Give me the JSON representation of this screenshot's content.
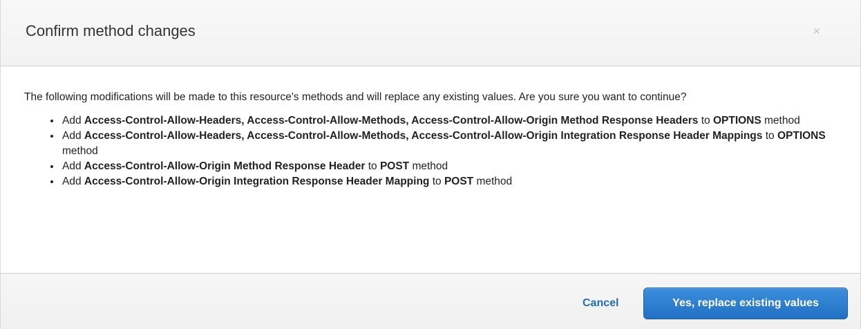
{
  "modal": {
    "title": "Confirm method changes",
    "close_glyph": "×"
  },
  "body": {
    "intro": "The following modifications will be made to this resource's methods and will replace any existing values. Are you sure you want to continue?",
    "items": [
      {
        "prefix": "Add ",
        "bold1": "Access-Control-Allow-Headers, Access-Control-Allow-Methods, Access-Control-Allow-Origin Method Response Headers",
        "mid": " to ",
        "bold2": "OPTIONS",
        "suffix": " method"
      },
      {
        "prefix": "Add ",
        "bold1": "Access-Control-Allow-Headers, Access-Control-Allow-Methods, Access-Control-Allow-Origin Integration Response Header Mappings",
        "mid": " to ",
        "bold2": "OPTIONS",
        "suffix": " method"
      },
      {
        "prefix": "Add ",
        "bold1": "Access-Control-Allow-Origin Method Response Header",
        "mid": " to ",
        "bold2": "POST",
        "suffix": " method"
      },
      {
        "prefix": "Add ",
        "bold1": "Access-Control-Allow-Origin Integration Response Header Mapping",
        "mid": " to ",
        "bold2": "POST",
        "suffix": " method"
      }
    ]
  },
  "footer": {
    "cancel_label": "Cancel",
    "confirm_label": "Yes, replace existing values"
  },
  "colors": {
    "accent": "#2270c4",
    "link": "#1f6fb5"
  },
  "icons": {
    "close": "close-icon"
  }
}
